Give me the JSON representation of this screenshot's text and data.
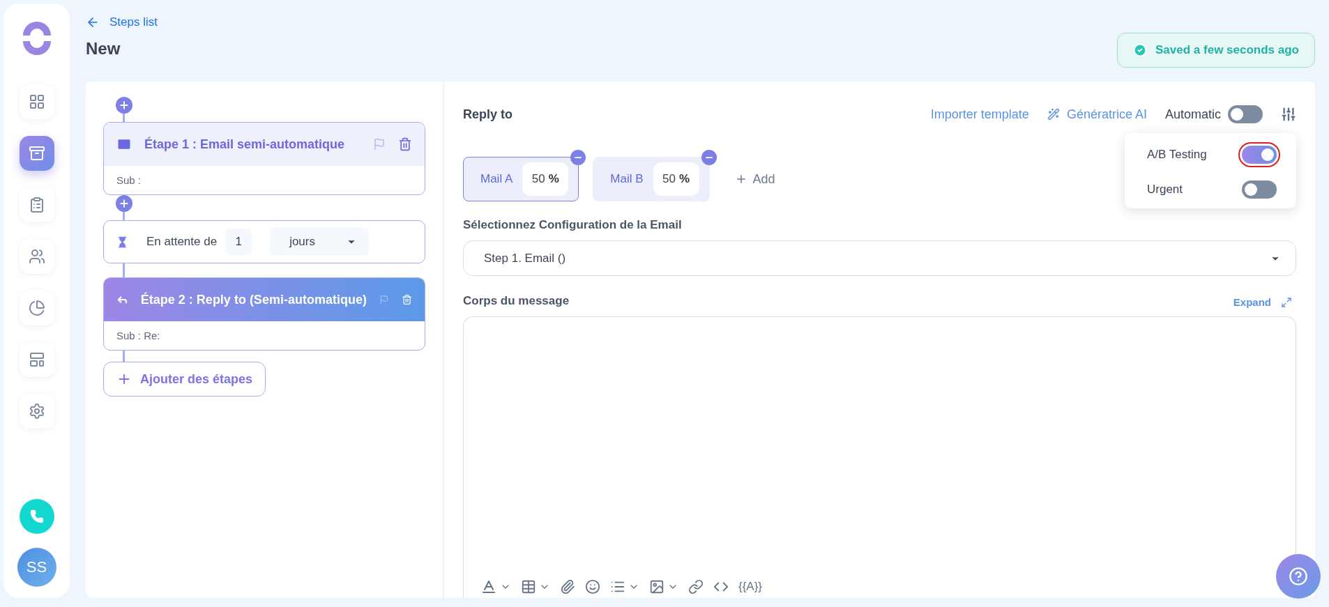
{
  "sidebar": {
    "nav": [
      {
        "kind": "dashboard",
        "selected": false
      },
      {
        "kind": "campaigns",
        "selected": true
      },
      {
        "kind": "tasks",
        "selected": false
      },
      {
        "kind": "contacts",
        "selected": false
      },
      {
        "kind": "reports",
        "selected": false
      },
      {
        "kind": "templates",
        "selected": false
      },
      {
        "kind": "settings",
        "selected": false
      }
    ],
    "avatar": "SS"
  },
  "header": {
    "back_link": "Steps list",
    "title": "New",
    "save_status": "Saved a few seconds ago"
  },
  "steps": [
    {
      "kind": "email",
      "title": "Étape 1 : Email semi-automatique",
      "subject": "Sub :",
      "selected": false
    },
    {
      "kind": "wait",
      "label": "En attente de",
      "count": "1",
      "unit": "jours"
    },
    {
      "kind": "reply",
      "title": "Étape 2 : Reply to (Semi-automatique)",
      "subject": "Sub : Re:",
      "selected": true
    }
  ],
  "add_steps_button": "Ajouter des étapes",
  "editor": {
    "title": "Reply to",
    "import_link": "Importer template",
    "ai_link": "Génératrice AI",
    "automatic": {
      "label": "Automatic",
      "on": false
    },
    "options": [
      {
        "label": "A/B Testing",
        "on": true,
        "highlighted": true
      },
      {
        "label": "Urgent",
        "on": false,
        "highlighted": false
      }
    ],
    "variants": [
      {
        "label": "Mail A",
        "share": "50",
        "unit": "%",
        "selected": true
      },
      {
        "label": "Mail B",
        "share": "50",
        "unit": "%",
        "selected": false
      }
    ],
    "add_variant": "Add",
    "config_label": "Sélectionnez Configuration de la Email",
    "config_value": "Step 1. Email ()",
    "body_label": "Corps du message",
    "expand": "Expand",
    "variable_button": "{{A}}"
  }
}
